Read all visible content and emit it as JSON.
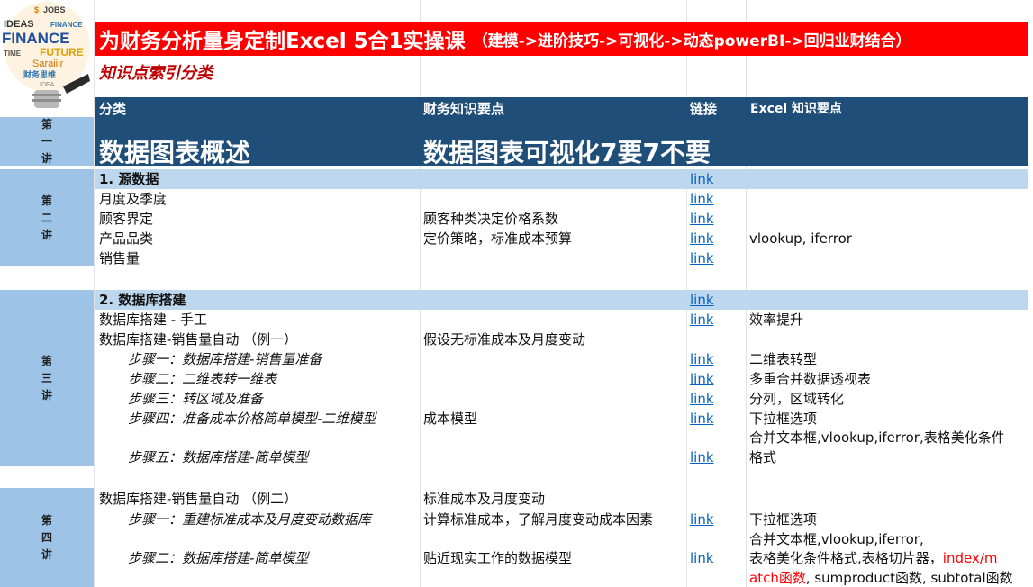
{
  "logo": {
    "words": [
      "JOBS",
      "IDEAS",
      "FINANCE",
      "TIME",
      "FUTURE",
      "Saraiiir",
      "IDEA",
      "财务思维"
    ]
  },
  "banner": {
    "main": "为财务分析量身定制Excel 5合1实操课",
    "sub": "（建模->进阶技巧->可视化->动态powerBI->回归业财结合）"
  },
  "subtitle": "知识点索引分类",
  "header": {
    "category": "分类",
    "finance": "财务知识要点",
    "link": "链接",
    "excel": "Excel 知识要点"
  },
  "lecture1": {
    "label": [
      "第",
      "一",
      "讲"
    ],
    "title": "数据图表概述",
    "finance": "数据图表可视化7要7不要"
  },
  "lecture2": {
    "label": [
      "第",
      "二",
      "讲"
    ],
    "section": "1. 源数据",
    "section_link": "link",
    "rows": [
      {
        "category": "月度及季度",
        "finance": "",
        "link": "link",
        "excel": ""
      },
      {
        "category": "顾客界定",
        "finance": "顾客种类决定价格系数",
        "link": "link",
        "excel": ""
      },
      {
        "category": "产品品类",
        "finance": "定价策略，标准成本预算",
        "link": "link",
        "excel": "vlookup, iferror"
      },
      {
        "category": "销售量",
        "finance": "",
        "link": "link",
        "excel": ""
      }
    ]
  },
  "lecture3": {
    "label": [
      "第",
      "三",
      "讲"
    ],
    "section": "2. 数据库搭建",
    "section_link": "link",
    "rows": [
      {
        "category": "数据库搭建 - 手工",
        "finance": "",
        "link": "link",
        "excel": "效率提升"
      },
      {
        "category": "数据库搭建-销售量自动 （例一）",
        "finance": "假设无标准成本及月度变动",
        "link": "",
        "excel": ""
      },
      {
        "category": "步骤一：数据库搭建-销售量准备",
        "finance": "",
        "link": "link",
        "excel": "二维表转型"
      },
      {
        "category": "步骤二：二维表转一维表",
        "finance": "",
        "link": "link",
        "excel": "多重合并数据透视表"
      },
      {
        "category": "步骤三：转区域及准备",
        "finance": "",
        "link": "link",
        "excel": "分列，区域转化"
      },
      {
        "category": "步骤四：准备成本价格简单模型-二维模型",
        "finance": "成本模型",
        "link": "link",
        "excel": "下拉框选项"
      },
      {
        "category": "",
        "finance": "",
        "link": "",
        "excel": "合并文本框,vlookup,iferror,表格美化条件"
      },
      {
        "category": "步骤五：数据库搭建-简单模型",
        "finance": "",
        "link": "link",
        "excel": "格式"
      }
    ]
  },
  "lecture4": {
    "label": [
      "第",
      "四",
      "讲"
    ],
    "rows": [
      {
        "category": "数据库搭建-销售量自动 （例二）",
        "finance": "标准成本及月度变动",
        "link": "",
        "excel": ""
      },
      {
        "category": "步骤一：重建标准成本及月度变动数据库",
        "finance": "计算标准成本，了解月度变动成本因素",
        "link": "link",
        "excel": "下拉框选项"
      },
      {
        "category": "",
        "finance": "",
        "link": "",
        "excel": "合并文本框,vlookup,iferror,"
      },
      {
        "category": "步骤二：数据库搭建-简单模型",
        "finance": "贴近现实工作的数据模型",
        "link": "link",
        "excel": "表格美化条件格式,表格切片器，"
      }
    ],
    "excel_red_1": "index/m",
    "excel_red_2": "atch函数",
    "excel_tail": ", sumproduct函数, subtotal函数"
  }
}
